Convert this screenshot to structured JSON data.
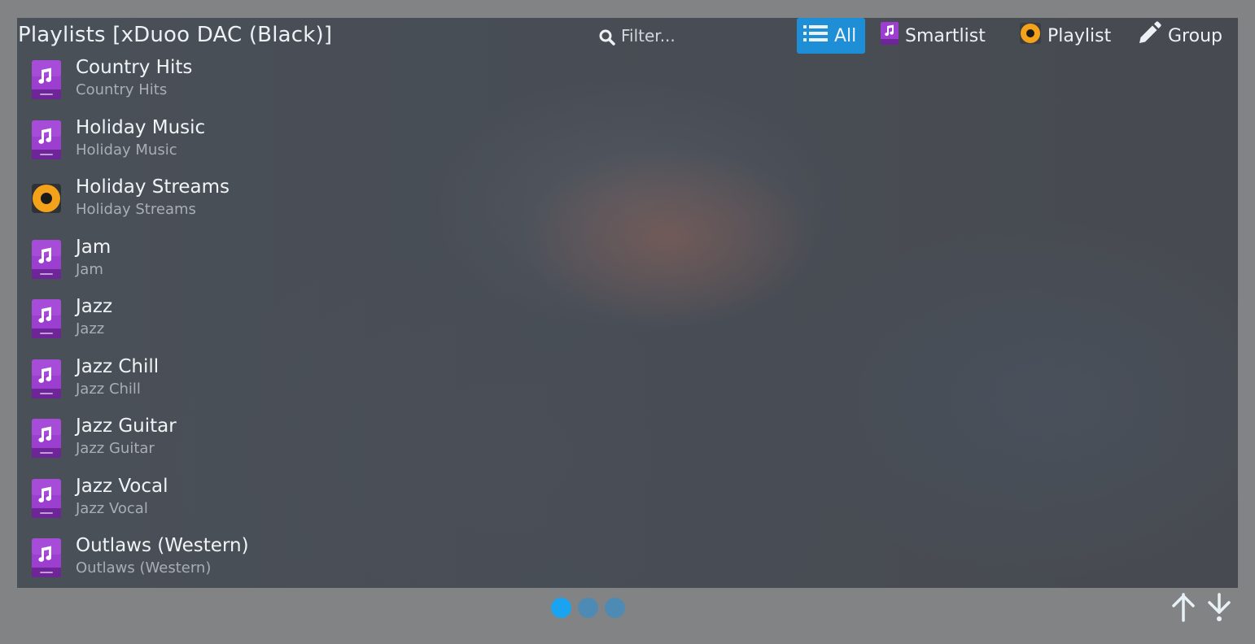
{
  "header": {
    "title": "Playlists [xDuoo DAC (Black)]",
    "filter_placeholder": "Filter...",
    "search_icon": "search-icon",
    "buttons": [
      {
        "label": "All",
        "icon": "list-icon",
        "active": true
      },
      {
        "label": "Smartlist",
        "icon": "smartlist-icon",
        "active": false
      },
      {
        "label": "Playlist",
        "icon": "speaker-icon",
        "active": false
      },
      {
        "label": "Group",
        "icon": "pencil-icon",
        "active": false
      }
    ]
  },
  "playlists": [
    {
      "name": "Country Hits",
      "sub": "Country Hits",
      "type": "playlist"
    },
    {
      "name": "Holiday Music",
      "sub": "Holiday Music",
      "type": "playlist"
    },
    {
      "name": "Holiday Streams",
      "sub": "Holiday Streams",
      "type": "stream"
    },
    {
      "name": "Jam",
      "sub": "Jam",
      "type": "playlist"
    },
    {
      "name": "Jazz",
      "sub": "Jazz",
      "type": "playlist"
    },
    {
      "name": "Jazz Chill",
      "sub": "Jazz Chill",
      "type": "playlist"
    },
    {
      "name": "Jazz Guitar",
      "sub": "Jazz Guitar",
      "type": "playlist"
    },
    {
      "name": "Jazz Vocal",
      "sub": "Jazz Vocal",
      "type": "playlist"
    },
    {
      "name": "Outlaws (Western)",
      "sub": "Outlaws (Western)",
      "type": "playlist"
    }
  ],
  "pager": {
    "count": 3,
    "current": 1
  },
  "nav": {
    "up_icon": "scroll-top-icon",
    "down_icon": "scroll-bottom-icon"
  },
  "colors": {
    "accent": "#1e8ed6",
    "dot_active": "#1aa3f0",
    "dot_inactive": "#4e8bb4",
    "playlist_icon": "#9c3fd0",
    "stream_icon": "#f5a21b",
    "frame": "#828384"
  }
}
